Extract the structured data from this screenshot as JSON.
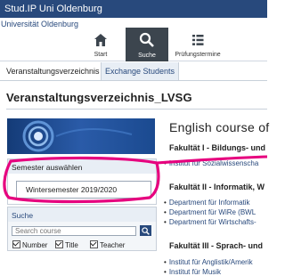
{
  "topbar": {
    "title": "Stud.IP Uni Oldenburg"
  },
  "header": {
    "university": "Universität Oldenburg",
    "nav": [
      {
        "label": "Start",
        "icon": "home-icon"
      },
      {
        "label": "Suche",
        "icon": "search-icon",
        "active": true
      },
      {
        "label": "Prüfungstermine",
        "icon": "list-icon"
      }
    ]
  },
  "tabs": [
    {
      "label": "Veranstaltungsverzeichnis"
    },
    {
      "label": "Exchange Students",
      "active": true
    }
  ],
  "page": {
    "title": "Veranstaltungsverzeichnis_LVSG"
  },
  "sidebar": {
    "semester": {
      "heading": "Semester auswählen",
      "selected": "Wintersemester 2019/2020"
    },
    "search": {
      "heading": "Suche",
      "placeholder": "Search course",
      "checkboxes": [
        {
          "label": "Number",
          "checked": true
        },
        {
          "label": "Title",
          "checked": true
        },
        {
          "label": "Teacher",
          "checked": true
        }
      ]
    }
  },
  "content": {
    "title": "English course of",
    "faculties": [
      {
        "name": "Fakultät I - Bildungs- und",
        "items": [
          "Institut für Sozialwissenscha"
        ]
      },
      {
        "name": "Fakultät II - Informatik, W",
        "items": [
          "Department für Informatik",
          "Department für WiRe (BWL",
          "Department für Wirtschafts-"
        ]
      },
      {
        "name": "Fakultät III - Sprach- und",
        "items": [
          "Institut für Anglistik/Amerik",
          "Institut für Musik"
        ]
      }
    ]
  },
  "colors": {
    "brand": "#28497c",
    "highlight": "#e6007e"
  }
}
